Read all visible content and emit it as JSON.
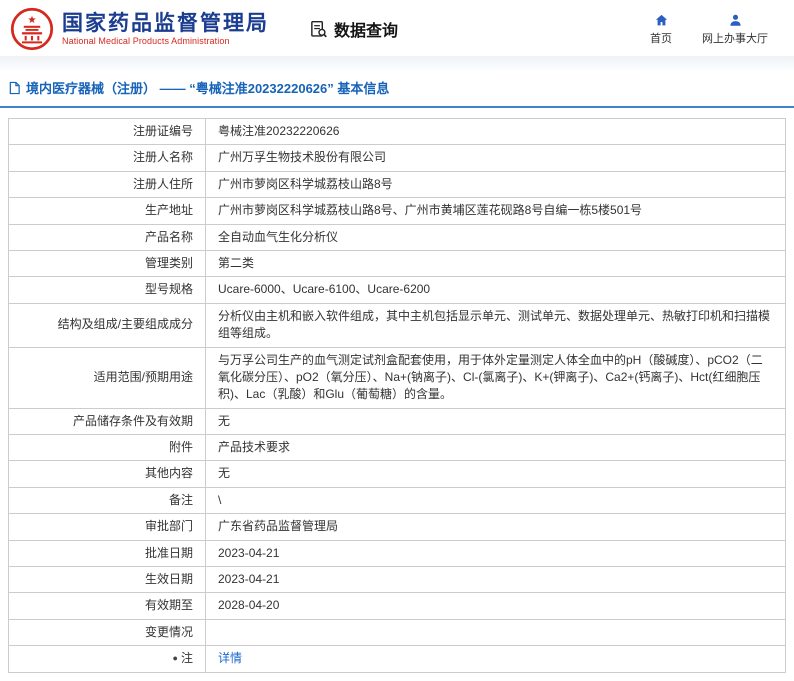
{
  "header": {
    "agency_cn": "国家药品监督管理局",
    "agency_en": "National Medical Products Administration",
    "section_title": "数据查询",
    "nav": [
      {
        "label": "首页",
        "icon": "home-icon"
      },
      {
        "label": "网上办事大厅",
        "icon": "user-icon"
      }
    ]
  },
  "breadcrumb": {
    "text": "境内医疗器械（注册） —— “粤械注准20232220626” 基本信息",
    "icon": "document-icon"
  },
  "colors": {
    "agency_blue": "#1b3d8f",
    "agency_red": "#d5281e",
    "breadcrumb_blue": "#1663b8",
    "divider_blue": "#3e86c6",
    "link_blue": "#1a66cc",
    "table_border": "#cccccc"
  },
  "table": {
    "rows": [
      {
        "label": "注册证编号",
        "value": "粤械注准20232220626"
      },
      {
        "label": "注册人名称",
        "value": "广州万孚生物技术股份有限公司"
      },
      {
        "label": "注册人住所",
        "value": "广州市萝岗区科学城荔枝山路8号"
      },
      {
        "label": "生产地址",
        "value": "广州市萝岗区科学城荔枝山路8号、广州市黄埔区莲花砚路8号自编一栋5楼501号"
      },
      {
        "label": "产品名称",
        "value": "全自动血气生化分析仪"
      },
      {
        "label": "管理类别",
        "value": "第二类"
      },
      {
        "label": "型号规格",
        "value": "Ucare-6000、Ucare-6100、Ucare-6200"
      },
      {
        "label": "结构及组成/主要组成成分",
        "value": "分析仪由主机和嵌入软件组成，其中主机包括显示单元、测试单元、数据处理单元、热敏打印机和扫描模组等组成。"
      },
      {
        "label": "适用范围/预期用途",
        "value": "与万孚公司生产的血气测定试剂盒配套使用，用于体外定量测定人体全血中的pH（酸碱度）、pCO2（二氧化碳分压）、pO2（氧分压）、Na+(钠离子)、Cl-(氯离子)、K+(钾离子)、Ca2+(钙离子)、Hct(红细胞压积)、Lac（乳酸）和Glu（葡萄糖）的含量。"
      },
      {
        "label": "产品储存条件及有效期",
        "value": "无"
      },
      {
        "label": "附件",
        "value": "产品技术要求"
      },
      {
        "label": "其他内容",
        "value": "无"
      },
      {
        "label": "备注",
        "value": "\\"
      },
      {
        "label": "审批部门",
        "value": "广东省药品监督管理局"
      },
      {
        "label": "批准日期",
        "value": "2023-04-21"
      },
      {
        "label": "生效日期",
        "value": "2023-04-21"
      },
      {
        "label": "有效期至",
        "value": "2028-04-20"
      },
      {
        "label": "变更情况",
        "value": ""
      },
      {
        "label": "注",
        "value": "详情",
        "icon": "note",
        "link": true
      }
    ]
  }
}
